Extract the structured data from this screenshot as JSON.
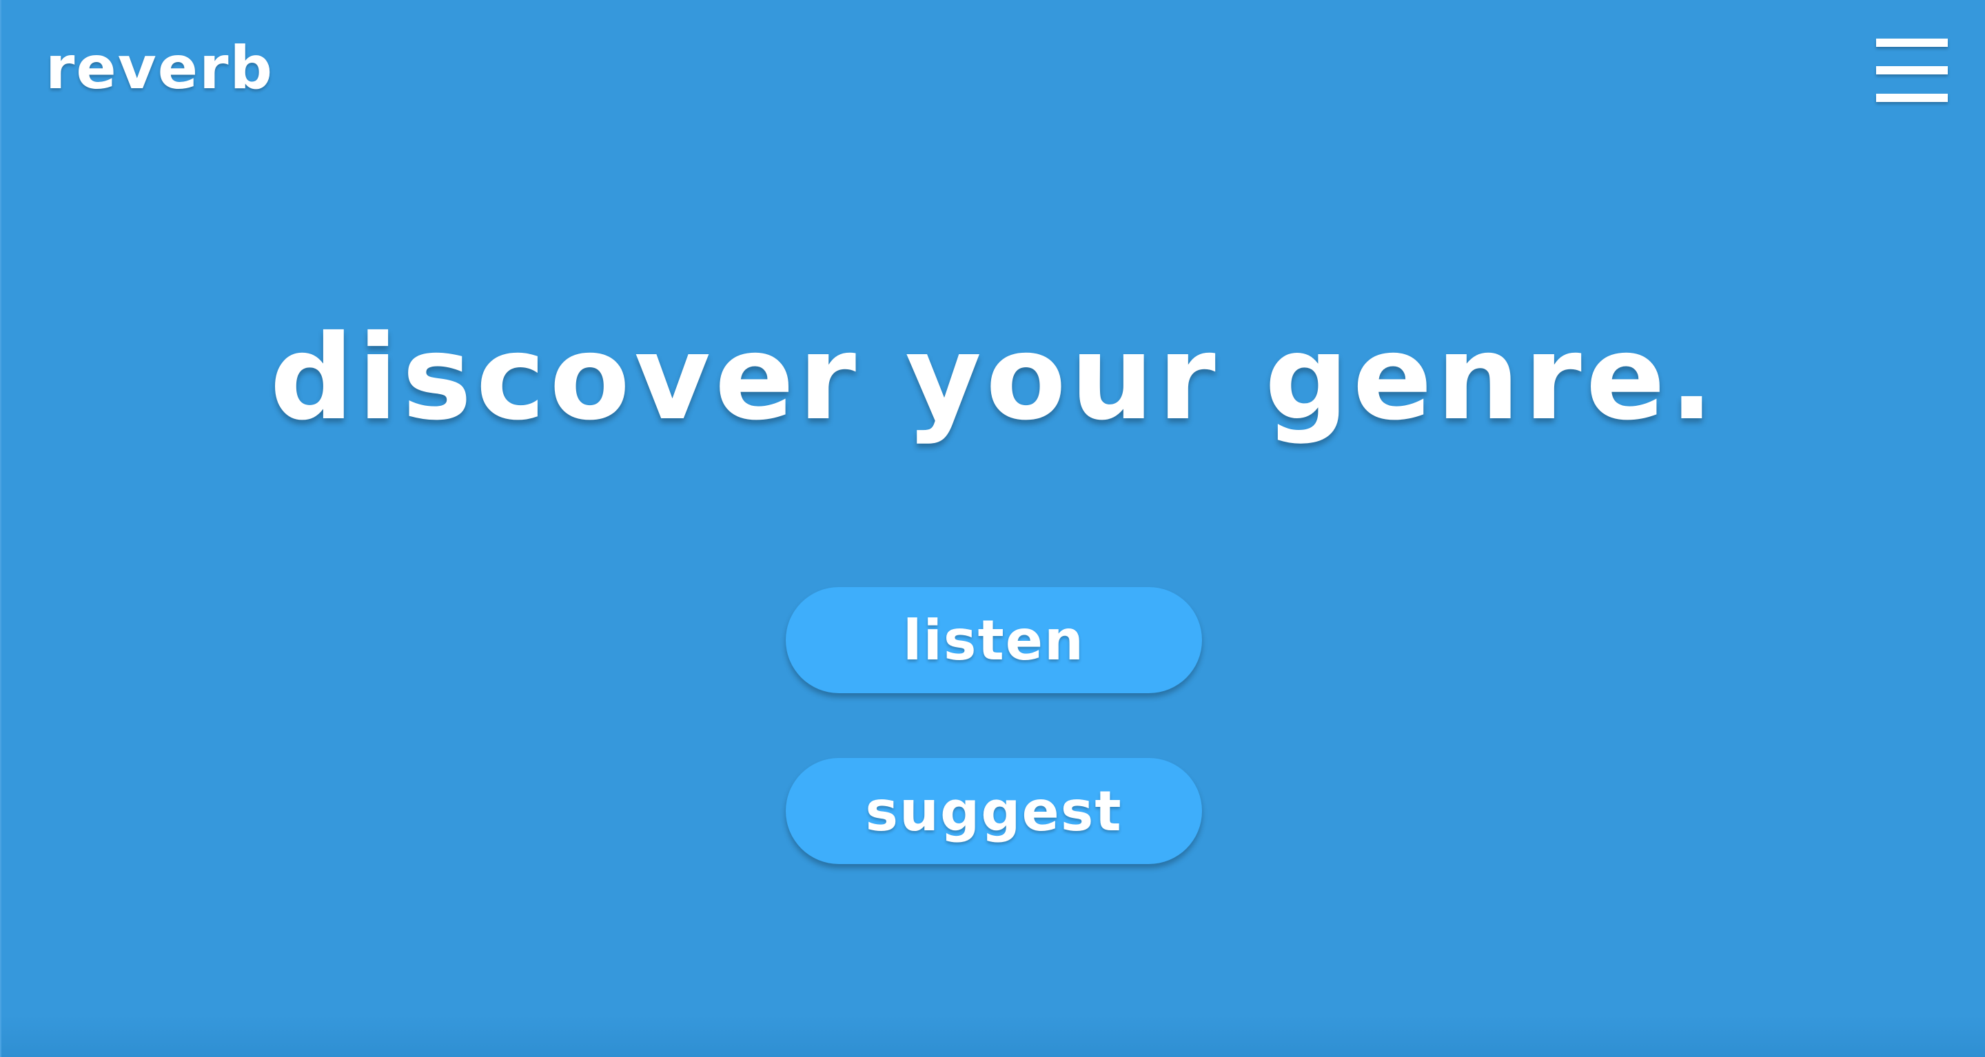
{
  "header": {
    "logo_text": "reverb",
    "menu_icon": "hamburger-menu-icon"
  },
  "hero": {
    "headline": "discover your genre."
  },
  "actions": {
    "listen_label": "listen",
    "suggest_label": "suggest"
  },
  "colors": {
    "background": "#3698dc",
    "button": "#3eaefb",
    "text": "#ffffff"
  }
}
